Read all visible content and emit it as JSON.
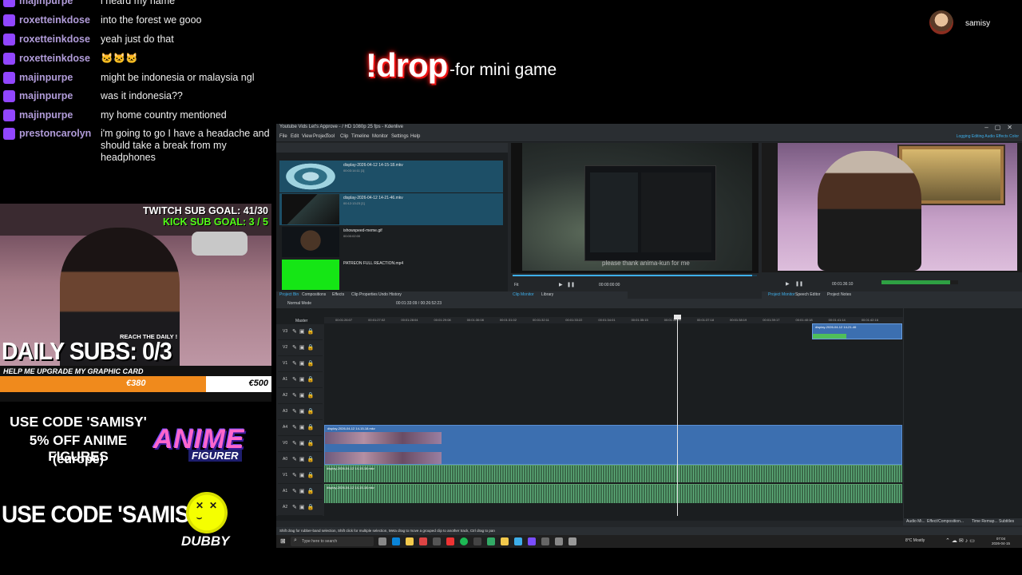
{
  "chat": {
    "messages": [
      {
        "user": "majinpurpe",
        "text": "i heard my name"
      },
      {
        "user": "roxetteinkdose",
        "text": "into the forest we gooo"
      },
      {
        "user": "roxetteinkdose",
        "text": "yeah just do that"
      },
      {
        "user": "roxetteinkdose",
        "text": "🐱🐱🐱"
      },
      {
        "user": "majinpurpe",
        "text": "might be indonesia or malaysia ngl"
      },
      {
        "user": "majinpurpe",
        "text": "was it indonesia??"
      },
      {
        "user": "majinpurpe",
        "text": "my home country mentioned"
      },
      {
        "user": "prestoncarolyn",
        "text": "i'm going to go I have a headache and should take a break from my headphones"
      }
    ],
    "user_color": "#b19cd9",
    "badge_color": "#9146ff"
  },
  "drop": {
    "command": "!drop",
    "description": "-for mini game"
  },
  "streamer": {
    "name": "samisy"
  },
  "goals": {
    "twitch": "TWITCH SUB GOAL: 41/30",
    "kick": "KICK SUB GOAL: 3 / 5",
    "reach_daily": "REACH THE DAILY !",
    "daily_subs": "DAILY SUBS: 0/3"
  },
  "upgrade": {
    "label": "HELP ME UPGRADE MY GRAPHIC CARD",
    "current": "€380",
    "target": "€500",
    "progress": 0.76
  },
  "promo": {
    "anime_line1": "USE CODE 'SAMISY'",
    "anime_line2": "5% OFF ANIME FIGURES",
    "anime_line3": "(europe)",
    "anime_logo": "ANIME",
    "anime_logo_sub": "FIGURER",
    "dubby_code": "USE CODE 'SAMISY'",
    "dubby_logo": "DUBBY"
  },
  "editor": {
    "title": "Youtube Vids Let's Approve - / HD 1080p 25 fps - Kdenlive",
    "menu": [
      "File",
      "Edit",
      "View",
      "Project",
      "Tool",
      "Clip",
      "Timeline",
      "Monitor",
      "Settings",
      "Help"
    ],
    "layouts": "Logging  Editing  Audio  Effects  Color",
    "bin_items": [
      {
        "name": "display-2026-04-12 14-15-18.mkv",
        "meta": "00:03:14:11 [1]"
      },
      {
        "name": "display-2026-04-12 14-21-46.mkv",
        "meta": "00:12:13:23 [1]"
      },
      {
        "name": "ishowspeed-meme.gif",
        "meta": "00:00:02:00"
      },
      {
        "name": "PATREON FULL REACTION.mp4",
        "meta": ""
      }
    ],
    "left_tabs": [
      "Project Bin",
      "Compositions",
      "Effects",
      "Clip Properties",
      "Undo History"
    ],
    "mid_tabs": [
      "Clip Monitor",
      "Library"
    ],
    "right_tabs": [
      "Project Monitor",
      "Speech Editor",
      "Project Notes"
    ],
    "clip_subtitle": "please thank anima-kun for me",
    "clip_zoom": "Fit",
    "clip_timecode": "00:00:00:00",
    "clip_progress": 0.98,
    "proj_timecode": "00:01:36:10",
    "proj_level": 0.9,
    "timeline_mode": "Normal Mode",
    "timeline_timecode": "00:01:33:09 / 00:26:52:23",
    "ruler": [
      "00:01:26:07",
      "00:01:27:02",
      "00:01:28:04",
      "00:01:29:08",
      "00:01:30:08",
      "00:01:31:02",
      "00:01:32:11",
      "00:01:33:22",
      "00:01:34:01",
      "00:01:35:15",
      "00:01:36:20",
      "00:01:37:18",
      "00:01:38:19",
      "00:01:39:17",
      "00:01:40:18",
      "00:01:41:14",
      "00:01:42:16"
    ],
    "track_labels": [
      "V3",
      "V2",
      "V1",
      "A1",
      "A2",
      "A3",
      "A4",
      "V0",
      "A0",
      "V1",
      "A1",
      "A2"
    ],
    "master_label": "Master",
    "clip_labels": {
      "top": "display-2026-04-12 14-21-46",
      "video": "display-2026-04-12 14-15-18.mkv",
      "audio1": "display-2026-04-12 14-15-18.mkv",
      "audio2": "display-2026-04-12 14-15-18.mkv"
    },
    "bottom_tabs": [
      "Audio Mi...",
      "Effect/Composition...",
      "Time Remap...",
      "Subtitles"
    ],
    "status": "Shift drag for rubber-band selection, Shift click for multiple selection, Meta drag to move a grouped clip to another track, Ctrl drag to pan"
  },
  "taskbar": {
    "search_placeholder": "Type here to search",
    "weather": "8°C Mostly",
    "time": "07:04",
    "date": "2026-04-15"
  }
}
